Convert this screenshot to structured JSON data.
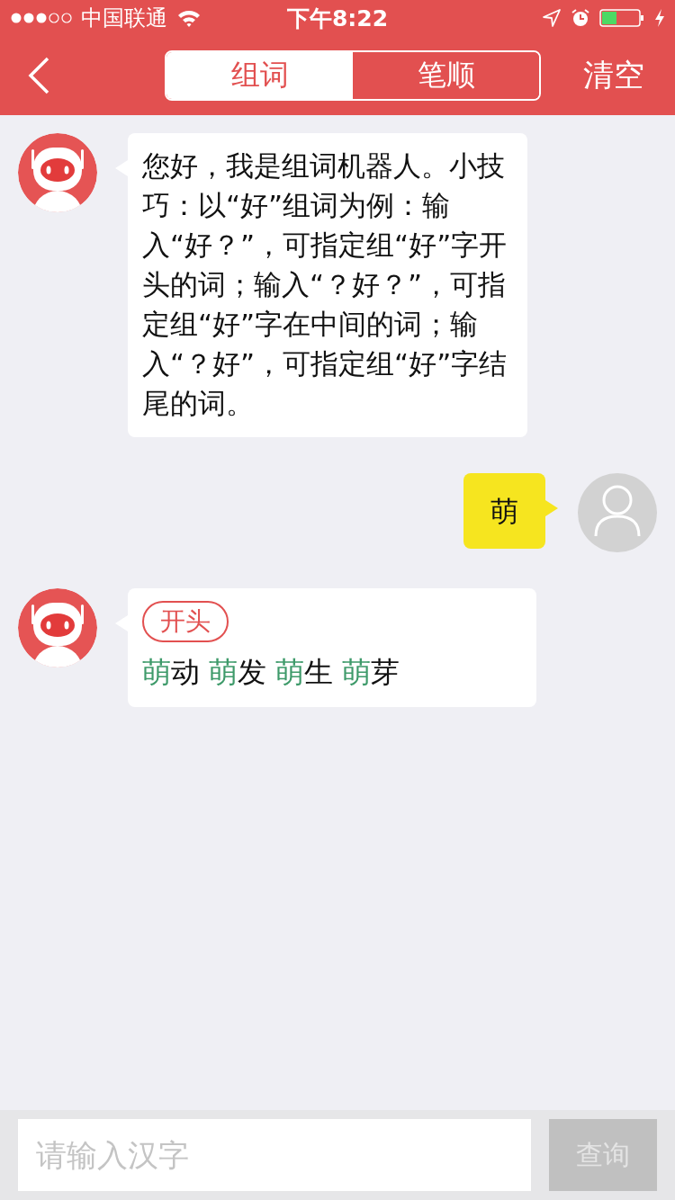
{
  "status_bar": {
    "carrier": "中国联通",
    "time": "下午8:22"
  },
  "nav": {
    "tabs": [
      {
        "label": "组词",
        "selected": true
      },
      {
        "label": "笔顺",
        "selected": false
      }
    ],
    "action": "清空"
  },
  "messages": [
    {
      "kind": "bot_text",
      "text": "您好，我是组词机器人。小技巧：以“好”组词为例：输入“好？”，可指定组“好”字开头的词；输入“？好？”，可指定组“好”字在中间的词；输入“？好”，可指定组“好”字结尾的词。"
    },
    {
      "kind": "user_text",
      "text": "萌"
    },
    {
      "kind": "bot_words",
      "tag": "开头",
      "words": [
        {
          "head": "萌",
          "tail": "动"
        },
        {
          "head": "萌",
          "tail": "发"
        },
        {
          "head": "萌",
          "tail": "生"
        },
        {
          "head": "萌",
          "tail": "芽"
        }
      ]
    }
  ],
  "input": {
    "placeholder": "请输入汉字",
    "button": "查询",
    "disabled": true
  }
}
